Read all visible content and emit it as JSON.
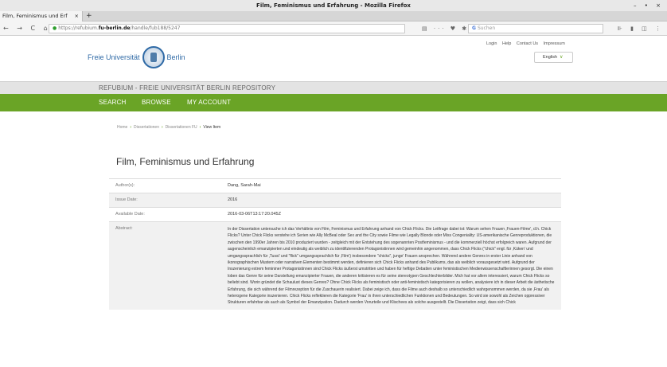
{
  "window": {
    "title": "Film, Feminismus und Erfahrung - Mozilla Firefox",
    "controls": "– • ×"
  },
  "tab": {
    "title": "Film, Feminismus und Erf",
    "close": "×",
    "new": "+"
  },
  "nav": {
    "buttons": "← → C ⌂",
    "url_prefix": "https://refubium.",
    "url_host": "fu-berlin.de",
    "url_path": "/handle/fub188/5247",
    "url_actions": "▤ ··· ♥ ✱ ☆",
    "search_placeholder": "Suchen",
    "search_g": "G",
    "toolbar_icons": "⊪ ▮ ◫ ⋮"
  },
  "header": {
    "logo_left": "Freie Universität",
    "logo_right": "Berlin",
    "links": [
      "Login",
      "Help",
      "Contact Us",
      "Impressum"
    ],
    "language": "English",
    "language_caret": "∨"
  },
  "repo_title": "REFUBIUM - FREIE UNIVERSITÄT BERLIN REPOSITORY",
  "mainnav": [
    "SEARCH",
    "BROWSE",
    "MY ACCOUNT"
  ],
  "breadcrumb": {
    "items": [
      "Home",
      "Dissertationen",
      "Dissertationen FU"
    ],
    "separator": "›",
    "current": "View Item"
  },
  "item": {
    "title": "Film, Feminismus und Erfahrung",
    "fields": [
      {
        "label": "Author(s):",
        "value": "Dang, Sarah-Mai"
      },
      {
        "label": "Issue Date:",
        "value": "2016"
      },
      {
        "label": "Available Date:",
        "value": "2016-03-06T13:17:20.045Z"
      },
      {
        "label": "Abstract:",
        "value": "In der Dissertation untersuche ich das Verhältnis von Film, Feminismus und Erfahrung anhand von Chick Flicks. Die Leitfrage dabei ist: Warum sehen Frauen ‚Frauen-Filme', d.h. Chick Flicks? Unter Chick Flicks verstehe ich Serien wie Ally McBeal oder Sex and the City sowie Filme wie Legally Blonde oder Miss Congeniality: US-amerikanische Genreproduktionen, die zwischen den 1990er Jahren bis 2010 produziert wurden - zeitgleich mit der Entstehung des sogenannten Postfeminismus - und die kommerziell höchst erfolgreich waren. Aufgrund der augenscheinlich emanzipierten und eindeutig als weiblich zu identifizierenden Protagonistinnen wird gemeinhin angenommen, dass Chick Flicks (\"chick\" engl. für ‚Küken' und umgangssprachlich für ‚Tussi' und \"flick\" umgangssprachlich für ‚Film') insbesondere \"chicks\", junge' Frauen ansprechen. Während andere Genres in erster Linie anhand von ikonographischen Mustern oder narrativen Elementen bestimmt werden, definieren sich Chick Flicks anhand des Publikums, das als weiblich vorausgesetzt wird. Aufgrund der Inszenierung extrem femininer Protagonistinnen sind Chick Flicks äußerst umstritten und haben für heftige Debatten unter feministischen Medienwissenschaftlerinnen gesorgt. Die einen loben das Genre für seine Darstellung emanzipierter Frauen, die anderen kritisieren es für seine stereotypen Geschlechterbilder. Mich hat vor allem interessiert, warum Chick Flicks so beliebt sind. Worin gründet die Schaulust dieses Genres? Ohne Chick Flicks als feministisch oder anti-feministisch kategorisieren zu wollen, analysiere ich in dieser Arbeit die ästhetische Erfahrung, die sich während der Filmrezeption für die Zuschauerin realisiert. Dabei zeige ich, dass die Filme auch deshalb so unterschiedlich wahrgenommen werden, da sie ‚Frau' als heterogene Kategorie inszenieren. Chick Flicks reflektieren die Kategorie 'Frau' in ihren unterschiedlichen Funktionen und Bedeutungen. So wird sie sowohl als Zeichen oppressiver Strukturen erfahrbar als auch als Symbol der Emanzipation. Dadurch werden Vorurteile und Klischees als solche ausgestellt. Die Dissertation zeigt, dass sich Chick"
      }
    ]
  }
}
